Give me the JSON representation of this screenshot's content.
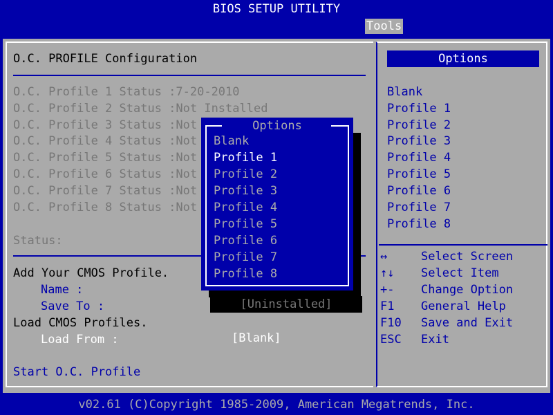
{
  "header": {
    "title": "BIOS SETUP UTILITY"
  },
  "tabs": [
    {
      "label": "Tools",
      "active": true
    }
  ],
  "section": {
    "title": "O.C. PROFILE Configuration"
  },
  "profiles": [
    "O.C. Profile 1 Status :7-20-2010",
    "O.C. Profile 2 Status :Not Installed",
    "O.C. Profile 3 Status :Not",
    "O.C. Profile 4 Status :Not",
    "O.C. Profile 5 Status :Not",
    "O.C. Profile 6 Status :Not",
    "O.C. Profile 7 Status :Not",
    "O.C. Profile 8 Status :Not"
  ],
  "status_label": "Status:",
  "add_profile": {
    "heading": "Add Your CMOS Profile.",
    "name_label": "Name :",
    "save_to_label": "Save To :",
    "save_to_value": "[Uninstalled]"
  },
  "load_profile": {
    "heading": "Load CMOS Profiles.",
    "load_from_label": "Load From :",
    "load_from_value": "[Blank]"
  },
  "start_oc": "Start O.C. Profile",
  "options_panel": {
    "header": "Options",
    "items": [
      "Blank",
      "Profile 1",
      "Profile 2",
      "Profile 3",
      "Profile 4",
      "Profile 5",
      "Profile 6",
      "Profile 7",
      "Profile 8"
    ]
  },
  "key_help": [
    {
      "key": "↔",
      "desc": "Select Screen"
    },
    {
      "key": "↑↓",
      "desc": "Select Item"
    },
    {
      "key": "+-",
      "desc": "Change Option"
    },
    {
      "key": "F1",
      "desc": "General Help"
    },
    {
      "key": "F10",
      "desc": "Save and Exit"
    },
    {
      "key": "ESC",
      "desc": "Exit"
    }
  ],
  "popup": {
    "title": "Options",
    "items": [
      "Blank",
      "Profile 1",
      "Profile 2",
      "Profile 3",
      "Profile 4",
      "Profile 5",
      "Profile 6",
      "Profile 7",
      "Profile 8"
    ],
    "selected_index": 1
  },
  "footer": {
    "text": "v02.61 (C)Copyright 1985-2009, American Megatrends, Inc."
  },
  "colors": {
    "background": "#0000aa",
    "panel": "#aaaaaa",
    "text_dim": "#777777",
    "highlight": "#ffffff"
  }
}
